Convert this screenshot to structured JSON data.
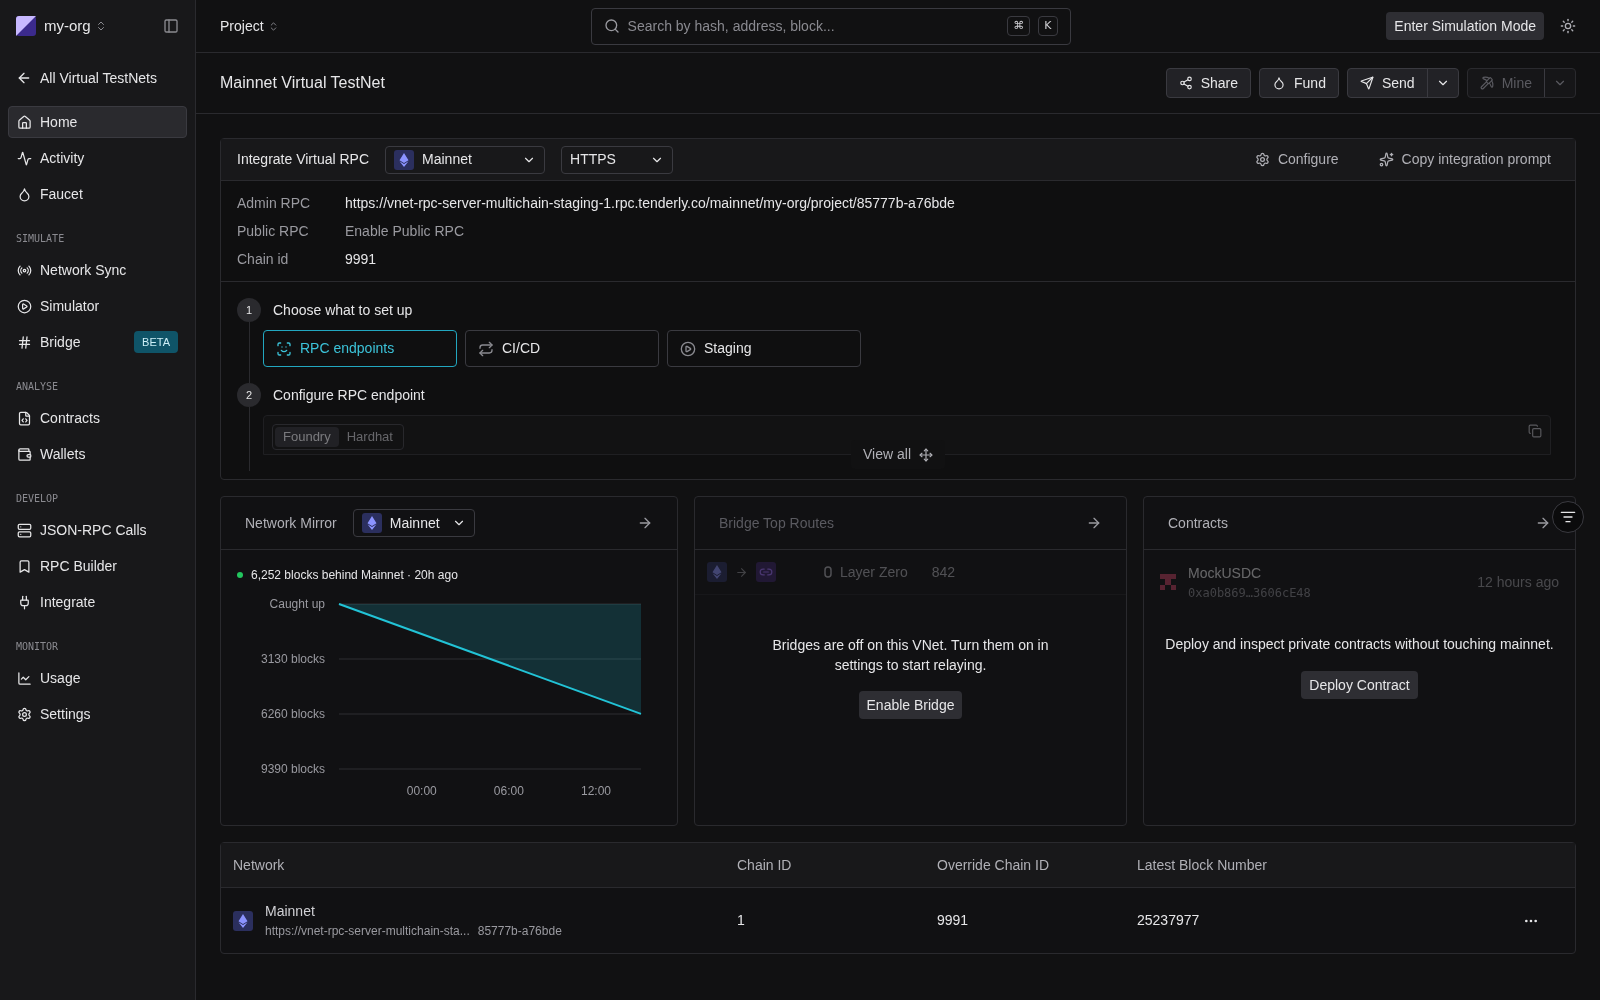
{
  "org": {
    "name": "my-org"
  },
  "back_link": "All Virtual TestNets",
  "sidebar": [
    {
      "items": [
        {
          "label": "Home",
          "selected": true
        },
        {
          "label": "Activity",
          "selected": false
        },
        {
          "label": "Faucet",
          "selected": false
        }
      ]
    },
    {
      "heading": "SIMULATE",
      "items": [
        {
          "label": "Network Sync",
          "selected": false
        },
        {
          "label": "Simulator",
          "selected": false
        },
        {
          "label": "Bridge",
          "selected": false,
          "badge": "BETA"
        }
      ]
    },
    {
      "heading": "ANALYSE",
      "items": [
        {
          "label": "Contracts",
          "selected": false
        },
        {
          "label": "Wallets",
          "selected": false
        }
      ]
    },
    {
      "heading": "DEVELOP",
      "items": [
        {
          "label": "JSON-RPC Calls",
          "selected": false
        },
        {
          "label": "RPC Builder",
          "selected": false
        },
        {
          "label": "Integrate",
          "selected": false
        }
      ]
    },
    {
      "heading": "MONITOR",
      "items": [
        {
          "label": "Usage",
          "selected": false
        },
        {
          "label": "Settings",
          "selected": false
        }
      ]
    }
  ],
  "topbar": {
    "project": "Project",
    "search": {
      "placeholder": "Search by hash, address, block...",
      "keys": [
        "⌘",
        "K"
      ]
    },
    "simulation_button": "Enter Simulation Mode"
  },
  "page": {
    "title": "Mainnet Virtual TestNet",
    "actions": [
      {
        "label": "Share",
        "disabled": false,
        "split": false
      },
      {
        "label": "Fund",
        "disabled": false,
        "split": false
      },
      {
        "label": "Send",
        "disabled": false,
        "split": true
      },
      {
        "label": "Mine",
        "disabled": true,
        "split": true
      }
    ]
  },
  "integrate": {
    "title": "Integrate Virtual RPC",
    "network": "Mainnet",
    "protocol": "HTTPS",
    "configure": "Configure",
    "copy_prompt": "Copy integration prompt",
    "rows": [
      {
        "label": "Admin RPC",
        "value": "https://vnet-rpc-server-multichain-staging-1.rpc.tenderly.co/mainnet/my-org/project/85777b-a76bde",
        "kind": "text"
      },
      {
        "label": "Public RPC",
        "value": "Enable Public RPC",
        "kind": "link"
      },
      {
        "label": "Chain id",
        "value": "9991",
        "kind": "text"
      }
    ],
    "steps": [
      {
        "number": "1",
        "title": "Choose what to set up",
        "options": [
          {
            "label": "RPC endpoints",
            "selected": true
          },
          {
            "label": "CI/CD",
            "selected": false
          },
          {
            "label": "Staging",
            "selected": false
          }
        ]
      },
      {
        "number": "2",
        "title": "Configure RPC endpoint",
        "tabs": [
          {
            "label": "Foundry",
            "selected": true
          },
          {
            "label": "Hardhat",
            "selected": false
          }
        ]
      }
    ],
    "view_all": "View all"
  },
  "network_mirror": {
    "title": "Network Mirror",
    "network": "Mainnet",
    "status": "6,252 blocks behind Mainnet · 20h ago",
    "chart_data": {
      "type": "area",
      "x": [
        -5.7,
        15.1
      ],
      "series": [
        {
          "color": "#22c3d6",
          "values": [
            0,
            6250
          ]
        }
      ],
      "xlim": [
        -5.7,
        15.1
      ],
      "ylim": [
        9390,
        0
      ],
      "xticks": [
        {
          "value": 0,
          "label": "00:00"
        },
        {
          "value": 6,
          "label": "06:00"
        },
        {
          "value": 12,
          "label": "12:00"
        }
      ],
      "yticks": [
        {
          "value": 0,
          "label": "Caught up"
        },
        {
          "value": 3130,
          "label": "3130 blocks"
        },
        {
          "value": 6260,
          "label": "6260 blocks"
        },
        {
          "value": 9390,
          "label": "9390 blocks"
        }
      ]
    }
  },
  "bridge": {
    "title": "Bridge Top Routes",
    "disabled": true,
    "route": {
      "provider": "Layer Zero",
      "count": "842"
    },
    "message": "Bridges are off on this VNet. Turn them on in settings to start relaying.",
    "button": "Enable Bridge"
  },
  "contracts": {
    "title": "Contracts",
    "contract": {
      "name": "MockUSDC",
      "address": "0xa0b869…3606cE48",
      "time": "12 hours ago"
    },
    "message": "Deploy and inspect private contracts without touching mainnet.",
    "button": "Deploy Contract"
  },
  "table": {
    "columns": [
      "Network",
      "Chain ID",
      "Override Chain ID",
      "Latest Block Number"
    ],
    "rows": [
      {
        "network": "Mainnet",
        "url": "https://vnet-rpc-server-multichain-sta...",
        "url_end": "85777b-a76bde",
        "chain_id": "1",
        "override_chain_id": "9991",
        "latest_block": "25237977"
      }
    ]
  }
}
